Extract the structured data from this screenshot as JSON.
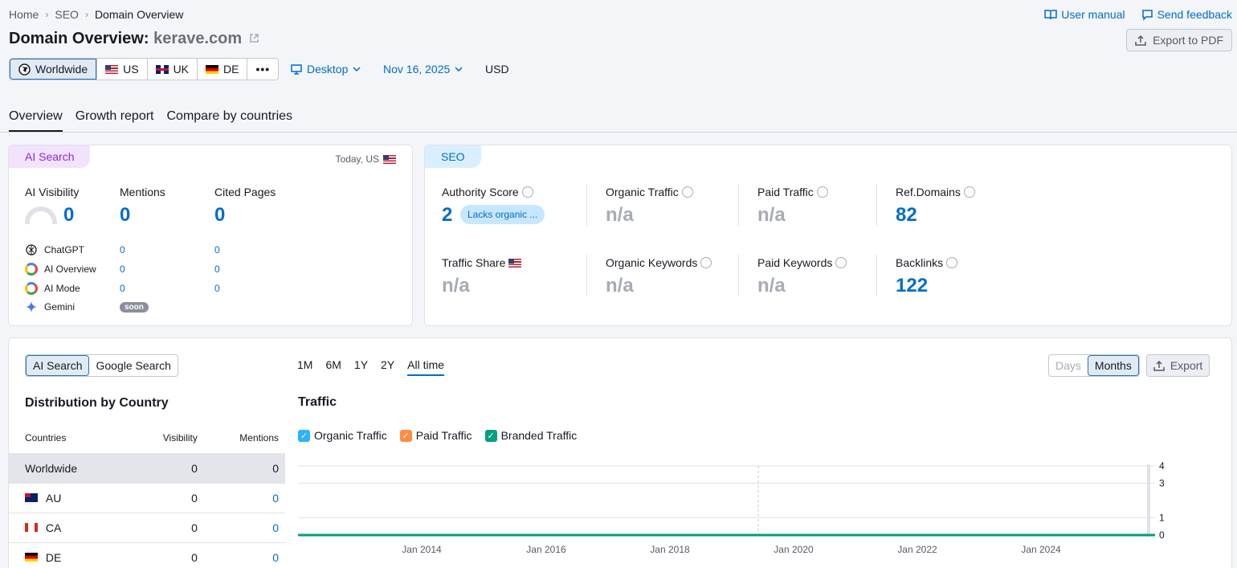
{
  "breadcrumb": [
    "Home",
    "SEO",
    "Domain Overview"
  ],
  "header": {
    "title_prefix": "Domain Overview:",
    "domain": "kerave.com",
    "user_manual": "User manual",
    "send_feedback": "Send feedback",
    "export_pdf": "Export to PDF"
  },
  "databases": [
    "Worldwide",
    "US",
    "UK",
    "DE"
  ],
  "device": "Desktop",
  "date": "Nov 16, 2025",
  "currency": "USD",
  "tabs": [
    "Overview",
    "Growth report",
    "Compare by countries"
  ],
  "ai_card": {
    "tag": "AI Search",
    "scope": "Today, US",
    "metrics": [
      {
        "label": "AI Visibility",
        "value": "0"
      },
      {
        "label": "Mentions",
        "value": "0"
      },
      {
        "label": "Cited Pages",
        "value": "0"
      }
    ],
    "sources": [
      {
        "name": "ChatGPT",
        "mentions": "0",
        "cited": "0"
      },
      {
        "name": "AI Overview",
        "mentions": "0",
        "cited": "0"
      },
      {
        "name": "AI Mode",
        "mentions": "0",
        "cited": "0"
      },
      {
        "name": "Gemini",
        "badge": "soon"
      }
    ]
  },
  "seo_card": {
    "tag": "SEO",
    "authority_label": "Authority Score",
    "authority_value": "2",
    "authority_badge": "Lacks organic ...",
    "organic_traffic_label": "Organic Traffic",
    "organic_traffic_value": "n/a",
    "paid_traffic_label": "Paid Traffic",
    "paid_traffic_value": "n/a",
    "ref_domains_label": "Ref.Domains",
    "ref_domains_value": "82",
    "traffic_share_label": "Traffic Share",
    "traffic_share_value": "n/a",
    "organic_keywords_label": "Organic Keywords",
    "organic_keywords_value": "n/a",
    "paid_keywords_label": "Paid Keywords",
    "paid_keywords_value": "n/a",
    "backlinks_label": "Backlinks",
    "backlinks_value": "122"
  },
  "bottom": {
    "source_toggle": [
      "AI Search",
      "Google Search"
    ],
    "periods": [
      "1M",
      "6M",
      "1Y",
      "2Y",
      "All time"
    ],
    "granularity": [
      "Days",
      "Months"
    ],
    "export": "Export",
    "dist_title": "Distribution by Country",
    "dist_headers": [
      "Countries",
      "Visibility",
      "Mentions"
    ],
    "dist_rows": [
      {
        "country": "Worldwide",
        "visibility": "0",
        "mentions": "0"
      },
      {
        "country": "AU",
        "visibility": "0",
        "mentions": "0"
      },
      {
        "country": "CA",
        "visibility": "0",
        "mentions": "0"
      },
      {
        "country": "DE",
        "visibility": "0",
        "mentions": "0"
      }
    ],
    "traffic_title": "Traffic",
    "legend": [
      "Organic Traffic",
      "Paid Traffic",
      "Branded Traffic"
    ]
  },
  "chart_data": {
    "type": "line",
    "title": "Traffic",
    "x_ticks": [
      "Jan 2014",
      "Jan 2016",
      "Jan 2018",
      "Jan 2020",
      "Jan 2022",
      "Jan 2024"
    ],
    "y_ticks": [
      "4",
      "3",
      "1",
      "0"
    ],
    "ylim": [
      0,
      4
    ],
    "series": [
      {
        "name": "Organic Traffic",
        "color": "#2bb3ff",
        "values": [
          0,
          0,
          0,
          0,
          0,
          0
        ]
      },
      {
        "name": "Paid Traffic",
        "color": "#ff8c43",
        "values": [
          0,
          0,
          0,
          0,
          0,
          0
        ]
      },
      {
        "name": "Branded Traffic",
        "color": "#009f81",
        "values": [
          0,
          0,
          0,
          0,
          0,
          0
        ]
      }
    ],
    "colors": {
      "organic": "#2bb3ff",
      "paid": "#ff8c43",
      "branded": "#009f81"
    }
  }
}
